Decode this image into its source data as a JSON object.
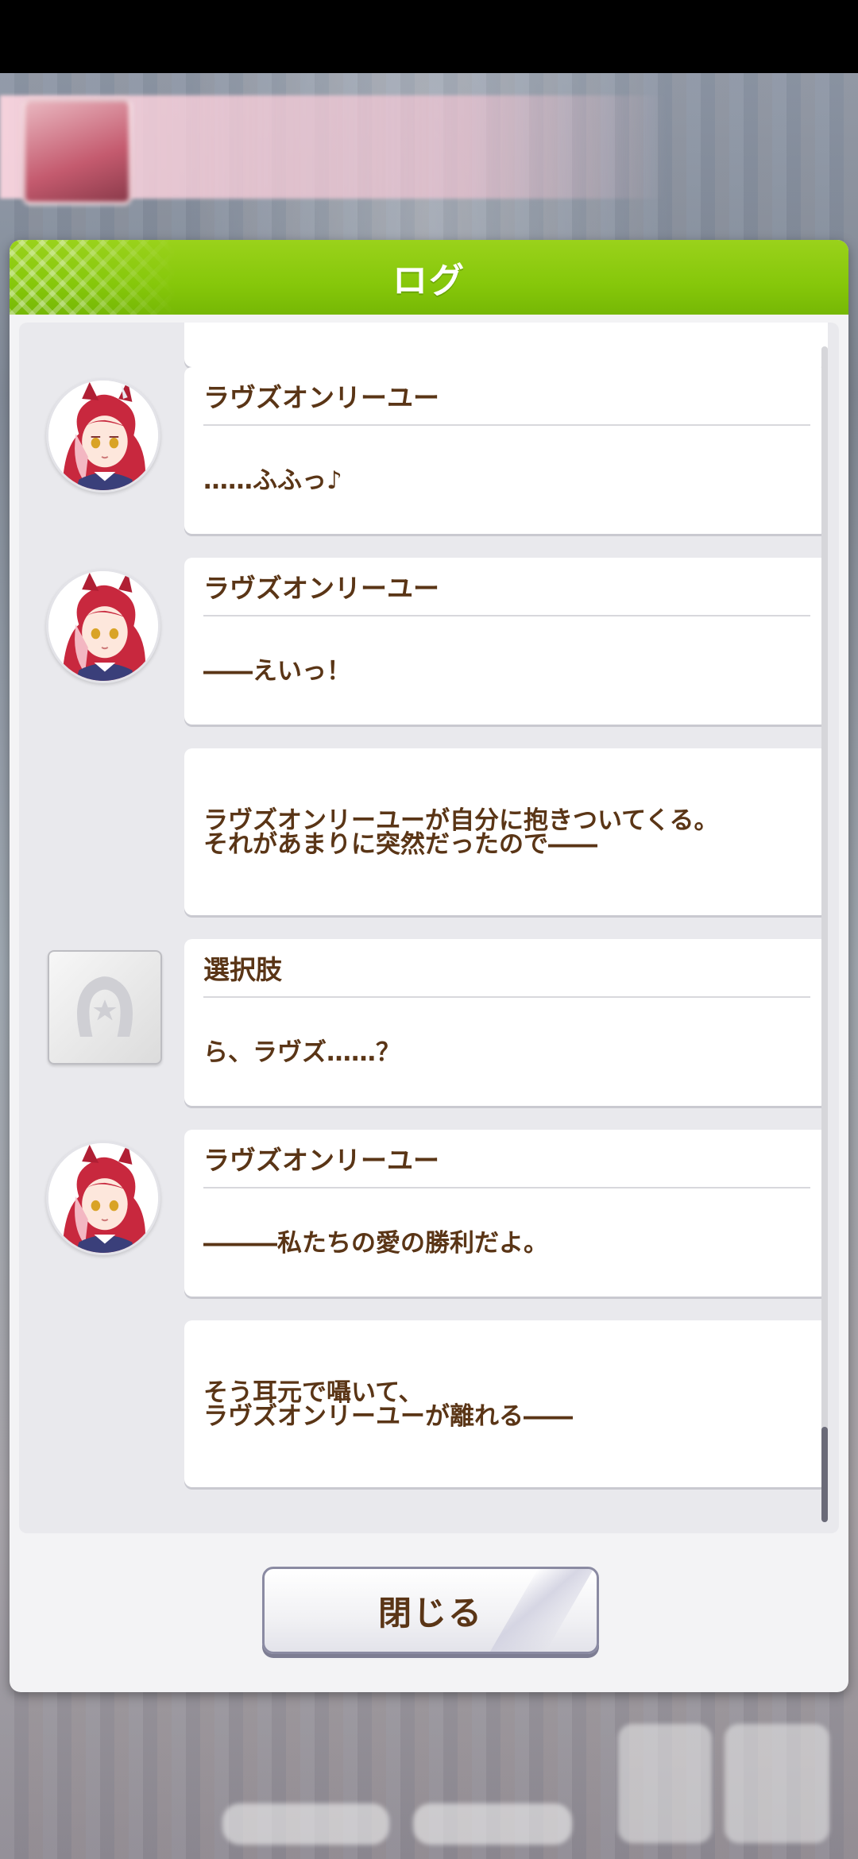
{
  "dialog": {
    "title": "ログ",
    "close_label": "閉じる"
  },
  "log": {
    "entries": [
      {
        "speaker": "ラヴズオンリーユー",
        "lines": [
          "……ふふっ♪"
        ],
        "avatar": "character-avatar"
      },
      {
        "speaker": "ラヴズオンリーユー",
        "lines": [
          "――えいっ！"
        ],
        "avatar": "character-avatar"
      },
      {
        "speaker": "",
        "lines": [
          "ラヴズオンリーユーが自分に抱きついてくる。",
          "それがあまりに突然だったので――"
        ],
        "avatar": null
      },
      {
        "speaker": "選択肢",
        "lines": [
          "ら、ラヴズ……？"
        ],
        "avatar": "choice-horseshoe-icon"
      },
      {
        "speaker": "ラヴズオンリーユー",
        "lines": [
          "―――私たちの愛の勝利だよ。"
        ],
        "avatar": "character-avatar"
      },
      {
        "speaker": "",
        "lines": [
          "そう耳元で囁いて、",
          "ラヴズオンリーユーが離れる――"
        ],
        "avatar": null
      }
    ]
  },
  "colors": {
    "header_green": "#86c70a",
    "text_brown": "#5a3516",
    "panel_bg": "#e9e9ed"
  }
}
